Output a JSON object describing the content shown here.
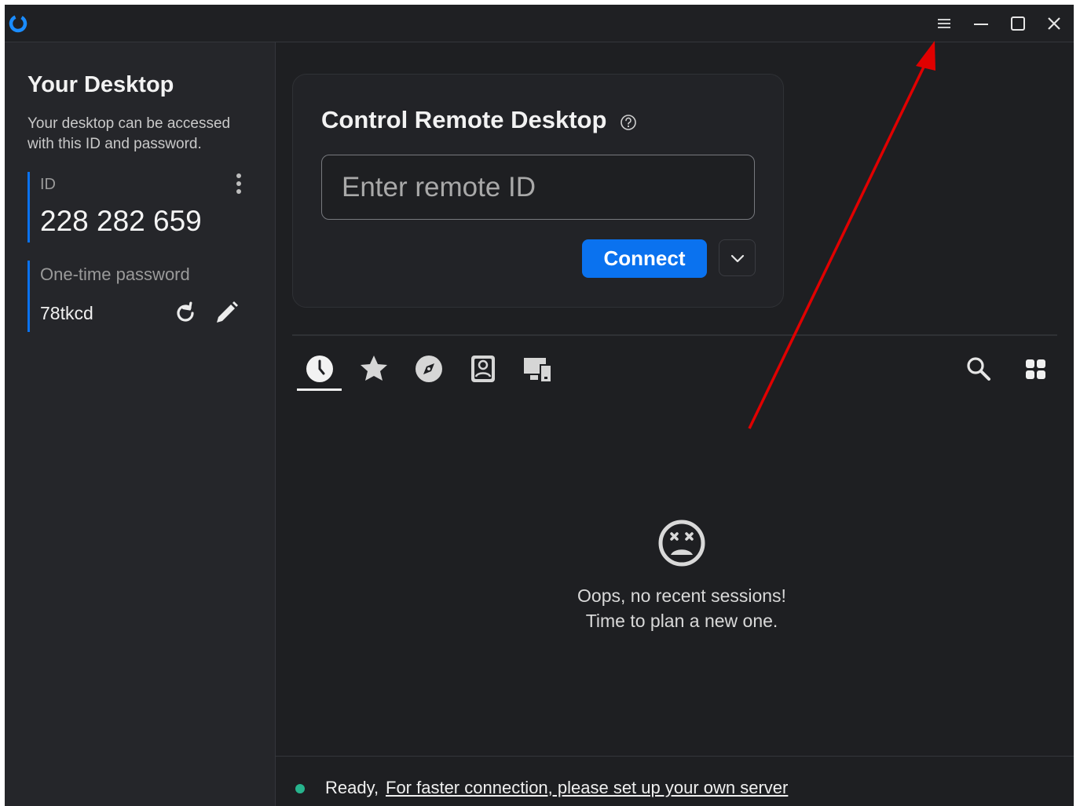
{
  "sidebar": {
    "title": "Your Desktop",
    "description": "Your desktop can be accessed with this ID and password.",
    "id_label": "ID",
    "id_value": "228 282 659",
    "password_label": "One-time password",
    "password_value": "78tkcd"
  },
  "main": {
    "card_title": "Control Remote Desktop",
    "remote_id_placeholder": "Enter remote ID",
    "connect_label": "Connect",
    "tabs": [
      "recent-sessions",
      "favorites",
      "discovered",
      "address-book",
      "accessible-devices"
    ],
    "empty_line1": "Oops, no recent sessions!",
    "empty_line2": "Time to plan a new one."
  },
  "status": {
    "ready_text": "Ready,",
    "link_text": "For faster connection, please set up your own server"
  },
  "icons": {
    "window": [
      "menu-icon",
      "minimize-icon",
      "maximize-icon",
      "close-icon"
    ],
    "sidebar": [
      "more-vertical-icon",
      "refresh-icon",
      "edit-icon"
    ],
    "main": [
      "help-icon",
      "chevron-down-icon",
      "search-icon",
      "grid-view-icon",
      "sad-face-icon"
    ]
  },
  "colors": {
    "accent": "#0a72ef",
    "background": "#1e1f22",
    "sidebar": "#25262a",
    "status_ok": "#27b48d",
    "annotation_arrow": "#e00000"
  }
}
